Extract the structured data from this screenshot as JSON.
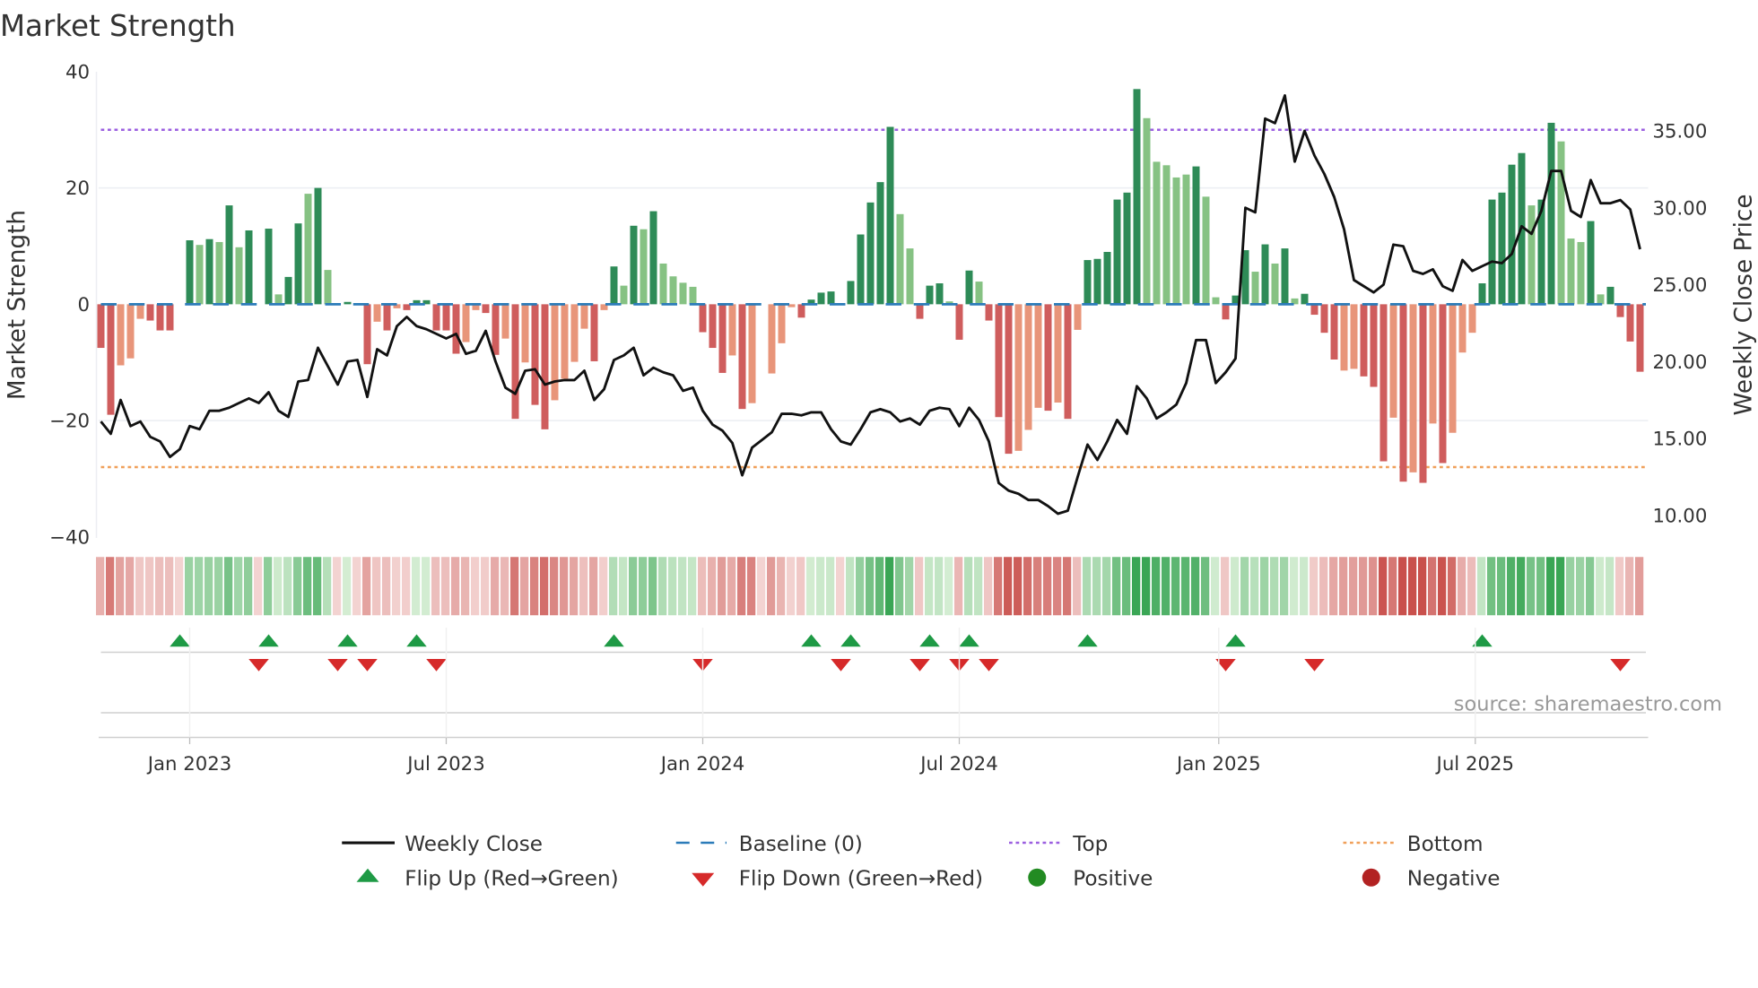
{
  "chart_data": {
    "type": "bar",
    "title": "Market Strength",
    "ylabel": "Market Strength",
    "y2label": "Weekly Close Price",
    "ylim": [
      -40,
      40
    ],
    "y2lim": [
      8.5,
      37.3
    ],
    "yticks": [
      "40",
      "20",
      "0",
      "−20",
      "−40"
    ],
    "ytick_values": [
      40,
      20,
      0,
      -20,
      -40
    ],
    "y2ticks": [
      "35.00",
      "30.00",
      "25.00",
      "20.00",
      "15.00",
      "10.00"
    ],
    "y2tick_values": [
      35,
      30,
      25,
      20,
      15,
      10
    ],
    "x_unit": "week index",
    "x_ticks": [
      {
        "label": "Jan 2023",
        "week": 9
      },
      {
        "label": "Jul 2023",
        "week": 35
      },
      {
        "label": "Jan 2024",
        "week": 61
      },
      {
        "label": "Jul 2024",
        "week": 87
      },
      {
        "label": "Jan 2025",
        "week": 113.3
      },
      {
        "label": "Jul 2025",
        "week": 139.3
      }
    ],
    "top_level": 30,
    "bottom_level": -28,
    "baseline": 0,
    "shade_legend": {
      "D": "strong positive",
      "L": "weak positive",
      "R": "strong negative",
      "O": "weak negative",
      "Z": "zero"
    },
    "bars": [
      [
        -7.5,
        "R"
      ],
      [
        -19,
        "R"
      ],
      [
        -10.5,
        "O"
      ],
      [
        -9.3,
        "O"
      ],
      [
        -2.5,
        "O"
      ],
      [
        -2.8,
        "R"
      ],
      [
        -4.5,
        "R"
      ],
      [
        -4.5,
        "R"
      ],
      [
        0,
        "Z"
      ],
      [
        11,
        "D"
      ],
      [
        10.2,
        "L"
      ],
      [
        11.2,
        "D"
      ],
      [
        10.7,
        "L"
      ],
      [
        17,
        "D"
      ],
      [
        9.8,
        "L"
      ],
      [
        12.7,
        "D"
      ],
      [
        0,
        "Z"
      ],
      [
        13,
        "D"
      ],
      [
        1.7,
        "L"
      ],
      [
        4.7,
        "D"
      ],
      [
        13.9,
        "D"
      ],
      [
        19,
        "L"
      ],
      [
        20,
        "D"
      ],
      [
        5.9,
        "L"
      ],
      [
        0,
        "Z"
      ],
      [
        0.4,
        "D"
      ],
      [
        0,
        "Z"
      ],
      [
        -10.3,
        "R"
      ],
      [
        -3,
        "O"
      ],
      [
        -4.5,
        "R"
      ],
      [
        -0.7,
        "O"
      ],
      [
        -1,
        "R"
      ],
      [
        0.7,
        "D"
      ],
      [
        0.7,
        "D"
      ],
      [
        -4.5,
        "R"
      ],
      [
        -4.5,
        "R"
      ],
      [
        -8.5,
        "R"
      ],
      [
        -6.5,
        "O"
      ],
      [
        -1,
        "O"
      ],
      [
        -1.5,
        "R"
      ],
      [
        -8.7,
        "R"
      ],
      [
        -5.9,
        "O"
      ],
      [
        -19.7,
        "R"
      ],
      [
        -10,
        "O"
      ],
      [
        -17.3,
        "R"
      ],
      [
        -21.5,
        "R"
      ],
      [
        -16.5,
        "O"
      ],
      [
        -12.8,
        "O"
      ],
      [
        -9.9,
        "O"
      ],
      [
        -4.2,
        "O"
      ],
      [
        -9.8,
        "R"
      ],
      [
        -1,
        "O"
      ],
      [
        6.5,
        "D"
      ],
      [
        3.2,
        "L"
      ],
      [
        13.5,
        "D"
      ],
      [
        12.9,
        "L"
      ],
      [
        16,
        "D"
      ],
      [
        7,
        "L"
      ],
      [
        4.8,
        "L"
      ],
      [
        3.7,
        "L"
      ],
      [
        3,
        "L"
      ],
      [
        -4.8,
        "R"
      ],
      [
        -7.5,
        "R"
      ],
      [
        -11.8,
        "R"
      ],
      [
        -8.8,
        "O"
      ],
      [
        -18,
        "R"
      ],
      [
        -17,
        "O"
      ],
      [
        0,
        "Z"
      ],
      [
        -11.9,
        "O"
      ],
      [
        -6.7,
        "O"
      ],
      [
        -0.5,
        "O"
      ],
      [
        -2.3,
        "R"
      ],
      [
        0.8,
        "D"
      ],
      [
        2,
        "D"
      ],
      [
        2.2,
        "D"
      ],
      [
        0,
        "Z"
      ],
      [
        4,
        "D"
      ],
      [
        12,
        "D"
      ],
      [
        17.5,
        "D"
      ],
      [
        21,
        "D"
      ],
      [
        30.5,
        "D"
      ],
      [
        15.5,
        "L"
      ],
      [
        9.6,
        "L"
      ],
      [
        -2.5,
        "R"
      ],
      [
        3.2,
        "D"
      ],
      [
        3.6,
        "D"
      ],
      [
        0.5,
        "L"
      ],
      [
        -6.1,
        "R"
      ],
      [
        5.8,
        "D"
      ],
      [
        3.9,
        "L"
      ],
      [
        -2.8,
        "R"
      ],
      [
        -19.4,
        "R"
      ],
      [
        -25.7,
        "R"
      ],
      [
        -25.2,
        "O"
      ],
      [
        -21.6,
        "O"
      ],
      [
        -17.8,
        "O"
      ],
      [
        -18.3,
        "R"
      ],
      [
        -16.9,
        "O"
      ],
      [
        -19.7,
        "R"
      ],
      [
        -4.4,
        "O"
      ],
      [
        7.6,
        "D"
      ],
      [
        7.8,
        "D"
      ],
      [
        9,
        "D"
      ],
      [
        18,
        "D"
      ],
      [
        19.2,
        "D"
      ],
      [
        37,
        "D"
      ],
      [
        32,
        "L"
      ],
      [
        24.5,
        "L"
      ],
      [
        23.9,
        "L"
      ],
      [
        21.8,
        "L"
      ],
      [
        22.3,
        "L"
      ],
      [
        23.7,
        "D"
      ],
      [
        18.5,
        "L"
      ],
      [
        1.2,
        "L"
      ],
      [
        -2.6,
        "R"
      ],
      [
        1.5,
        "D"
      ],
      [
        9.3,
        "D"
      ],
      [
        5.6,
        "L"
      ],
      [
        10.3,
        "D"
      ],
      [
        7,
        "L"
      ],
      [
        9.6,
        "D"
      ],
      [
        1,
        "L"
      ],
      [
        1.8,
        "D"
      ],
      [
        -1.8,
        "R"
      ],
      [
        -4.9,
        "R"
      ],
      [
        -9.5,
        "R"
      ],
      [
        -11.4,
        "O"
      ],
      [
        -11.1,
        "O"
      ],
      [
        -12.4,
        "R"
      ],
      [
        -14.2,
        "R"
      ],
      [
        -27,
        "R"
      ],
      [
        -19.5,
        "O"
      ],
      [
        -30.5,
        "R"
      ],
      [
        -28.9,
        "O"
      ],
      [
        -30.7,
        "R"
      ],
      [
        -20.5,
        "O"
      ],
      [
        -27.3,
        "R"
      ],
      [
        -22.1,
        "O"
      ],
      [
        -8.3,
        "O"
      ],
      [
        -4.9,
        "O"
      ],
      [
        3.6,
        "D"
      ],
      [
        18,
        "D"
      ],
      [
        19.2,
        "D"
      ],
      [
        24,
        "D"
      ],
      [
        26,
        "D"
      ],
      [
        17,
        "L"
      ],
      [
        18,
        "D"
      ],
      [
        31.2,
        "D"
      ],
      [
        28,
        "L"
      ],
      [
        11.3,
        "L"
      ],
      [
        10.7,
        "L"
      ],
      [
        14.3,
        "D"
      ],
      [
        1.7,
        "L"
      ],
      [
        3,
        "D"
      ],
      [
        -2.2,
        "R"
      ],
      [
        -6.4,
        "R"
      ],
      [
        -11.6,
        "R"
      ]
    ],
    "weekly_close": [
      16.1,
      15.3,
      17.5,
      15.8,
      16.1,
      15.1,
      14.8,
      13.8,
      14.3,
      15.8,
      15.6,
      16.8,
      16.8,
      17.0,
      17.3,
      17.6,
      17.3,
      18.0,
      16.8,
      16.4,
      18.7,
      18.8,
      20.9,
      19.7,
      18.5,
      20.0,
      20.1,
      17.7,
      20.8,
      20.4,
      22.3,
      22.9,
      22.3,
      22.1,
      21.8,
      21.5,
      21.8,
      20.5,
      20.7,
      22.0,
      20.0,
      18.3,
      17.9,
      19.4,
      19.5,
      18.5,
      18.7,
      18.8,
      18.8,
      19.4,
      17.5,
      18.2,
      20.1,
      20.4,
      20.9,
      19.1,
      19.6,
      19.3,
      19.1,
      18.1,
      18.3,
      16.8,
      15.9,
      15.5,
      14.7,
      12.6,
      14.4,
      14.9,
      15.4,
      16.6,
      16.6,
      16.5,
      16.7,
      16.7,
      15.6,
      14.8,
      14.6,
      15.6,
      16.7,
      16.9,
      16.7,
      16.1,
      16.3,
      15.9,
      16.8,
      17.0,
      16.9,
      15.8,
      17.0,
      16.2,
      14.8,
      12.1,
      11.6,
      11.4,
      11.0,
      11.0,
      10.6,
      10.1,
      10.3,
      12.5,
      14.6,
      13.6,
      14.8,
      16.2,
      15.3,
      18.4,
      17.6,
      16.3,
      16.7,
      17.2,
      18.6,
      21.4,
      21.4,
      18.6,
      19.3,
      20.2,
      30.0,
      29.7,
      35.8,
      35.5,
      37.3,
      33.0,
      35.0,
      33.4,
      32.2,
      30.7,
      28.6,
      25.3,
      24.9,
      24.5,
      25.0,
      27.6,
      27.5,
      25.9,
      25.7,
      26.0,
      24.9,
      24.6,
      26.6,
      25.9,
      26.2,
      26.5,
      26.4,
      27.0,
      28.8,
      28.3,
      29.8,
      32.4,
      32.4,
      29.8,
      29.4,
      31.8,
      30.3,
      30.3,
      30.5,
      29.9,
      27.3
    ],
    "flip_up_weeks": [
      8,
      17,
      25,
      32,
      52,
      72,
      76,
      84,
      88,
      100,
      115,
      140
    ],
    "flip_down_weeks": [
      16,
      24,
      27,
      34,
      61,
      75,
      83,
      87,
      90,
      114,
      123,
      154
    ],
    "legend": {
      "weekly_close": "Weekly Close",
      "baseline": "Baseline (0)",
      "top": "Top",
      "bottom": "Bottom",
      "flip_up": "Flip Up (Red→Green)",
      "flip_down": "Flip Down (Green→Red)",
      "positive": "Positive",
      "negative": "Negative"
    },
    "legend_placement": "bottom",
    "source": "source: sharemaestro.com",
    "colors": {
      "D": "#2e8b57",
      "L": "#86c283",
      "R": "#cf5d5d",
      "O": "#e8957a",
      "line": "#111111",
      "baseline": "#2b7bb9",
      "top": "#9b5fe0",
      "bottom": "#f0a05a",
      "flip_up": "#1e9a45",
      "flip_down": "#d62a2a",
      "positive": "#228b22",
      "negative": "#b22222"
    }
  }
}
